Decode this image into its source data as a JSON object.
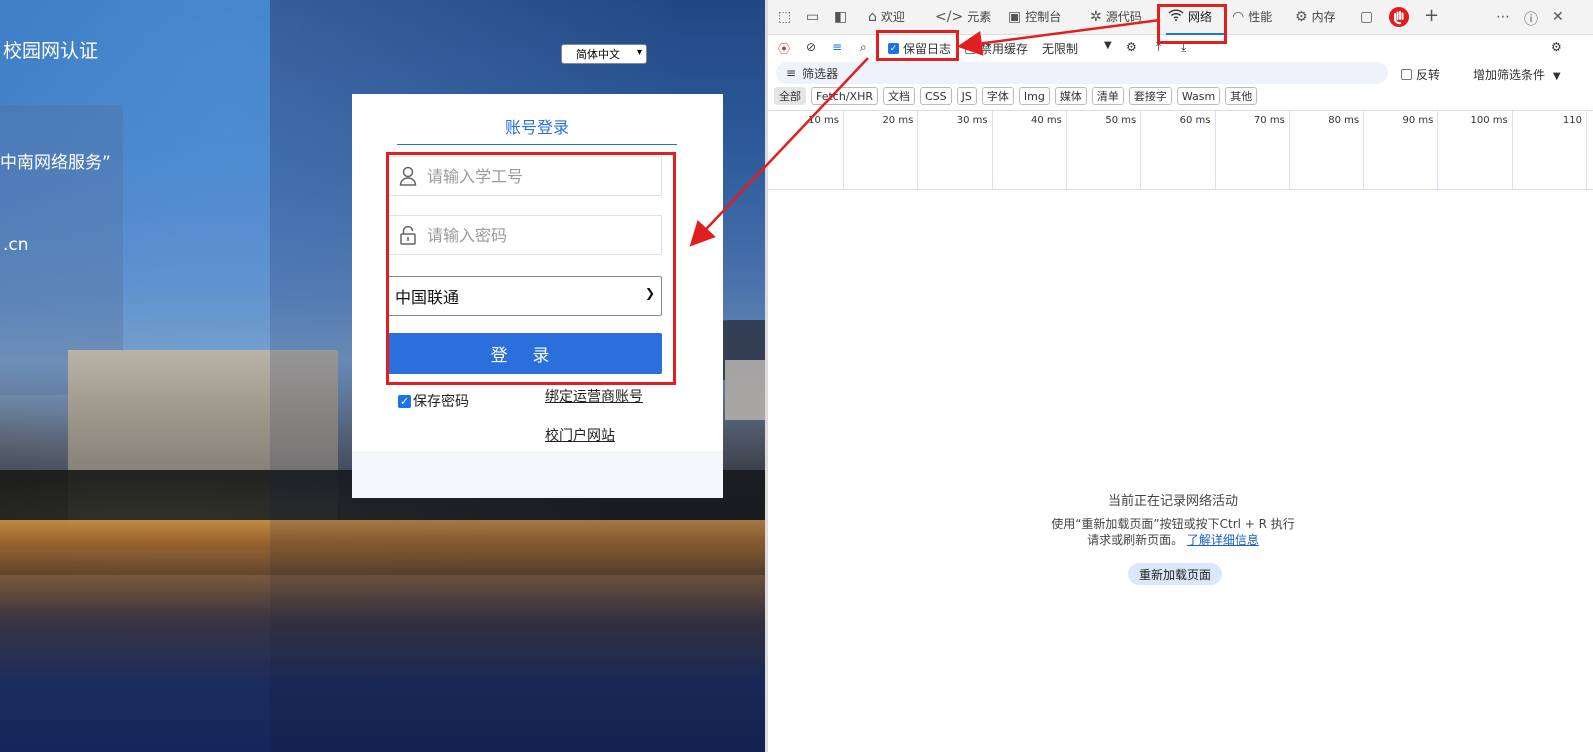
{
  "login_page": {
    "site_title": "校园网认证",
    "info_line_1": "中南网络服务”",
    "info_line_2": ".cn",
    "language": "简体中文",
    "tab_title": "账号登录",
    "username_placeholder": "请输入学工号",
    "password_placeholder": "请输入密码",
    "isp_selected": "中国联通",
    "login_button": "登 录",
    "remember_label": "保存密码",
    "bind_link": "绑定运营商账号",
    "portal_link": "校门户网站"
  },
  "devtools": {
    "tabs": [
      {
        "label": "欢迎",
        "icon": "home-icon"
      },
      {
        "label": "元素",
        "icon": "code-icon"
      },
      {
        "label": "控制台",
        "icon": "console-icon"
      },
      {
        "label": "源代码",
        "icon": "bug-icon"
      },
      {
        "label": "网络",
        "icon": "wifi-icon"
      },
      {
        "label": "性能",
        "icon": "gauge-icon"
      },
      {
        "label": "内存",
        "icon": "chip-icon"
      }
    ],
    "toolbar": {
      "preserve_log": "保留日志",
      "disable_cache": "禁用缓存",
      "throttle": "无限制"
    },
    "filter_placeholder": "筛选器",
    "invert_label": "反转",
    "more_filters": "增加筛选条件",
    "type_filters": [
      "全部",
      "Fetch/XHR",
      "文档",
      "CSS",
      "JS",
      "字体",
      "Img",
      "媒体",
      "清单",
      "套接字",
      "Wasm",
      "其他"
    ],
    "timeline_ticks": [
      "10 ms",
      "20 ms",
      "30 ms",
      "40 ms",
      "50 ms",
      "60 ms",
      "70 ms",
      "80 ms",
      "90 ms",
      "100 ms",
      "110"
    ],
    "empty_title": "当前正在记录网络活动",
    "empty_body": "使用“重新加载页面”按钮或按下Ctrl + R 执行请求或刷新页面。",
    "learn_more": "了解详细信息",
    "reload_button": "重新加载页面"
  },
  "colors": {
    "accent": "#2a6fdb",
    "annotation": "#e02020",
    "devtools_active": "#1a73e8"
  }
}
